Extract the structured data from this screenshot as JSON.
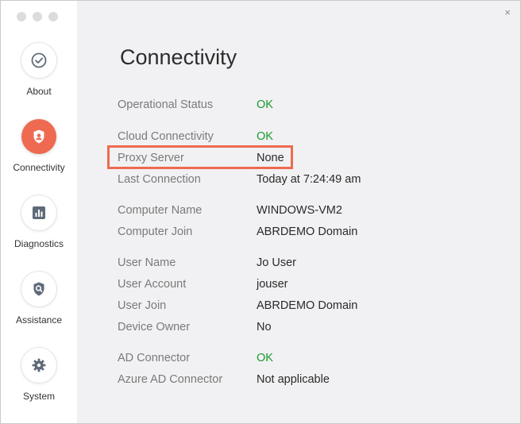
{
  "sidebar": {
    "items": [
      {
        "label": "About",
        "icon": "check-circle-icon"
      },
      {
        "label": "Connectivity",
        "icon": "shield-user-icon",
        "active": true
      },
      {
        "label": "Diagnostics",
        "icon": "bar-chart-icon"
      },
      {
        "label": "Assistance",
        "icon": "shield-search-icon"
      },
      {
        "label": "System",
        "icon": "gear-icon"
      }
    ]
  },
  "main": {
    "title": "Connectivity",
    "close_glyph": "×",
    "rows": [
      {
        "label": "Operational Status",
        "value": "OK"
      },
      {
        "label": "Cloud Connectivity",
        "value": "OK"
      },
      {
        "label": "Proxy Server",
        "value": "None"
      },
      {
        "label": "Last Connection",
        "value": "Today at 7:24:49 am"
      },
      {
        "label": "Computer Name",
        "value": "WINDOWS-VM2"
      },
      {
        "label": "Computer Join",
        "value": "ABRDEMO Domain"
      },
      {
        "label": "User Name",
        "value": "Jo User"
      },
      {
        "label": "User Account",
        "value": "jouser"
      },
      {
        "label": "User Join",
        "value": "ABRDEMO Domain"
      },
      {
        "label": "Device Owner",
        "value": "No"
      },
      {
        "label": "AD Connector",
        "value": "OK"
      },
      {
        "label": "Azure AD Connector",
        "value": "Not applicable"
      }
    ]
  },
  "colors": {
    "accent": "#ee6a51",
    "ok": "#1a9a2b",
    "sidebar_bg": "#ffffff",
    "content_bg": "#f1f1f3"
  }
}
